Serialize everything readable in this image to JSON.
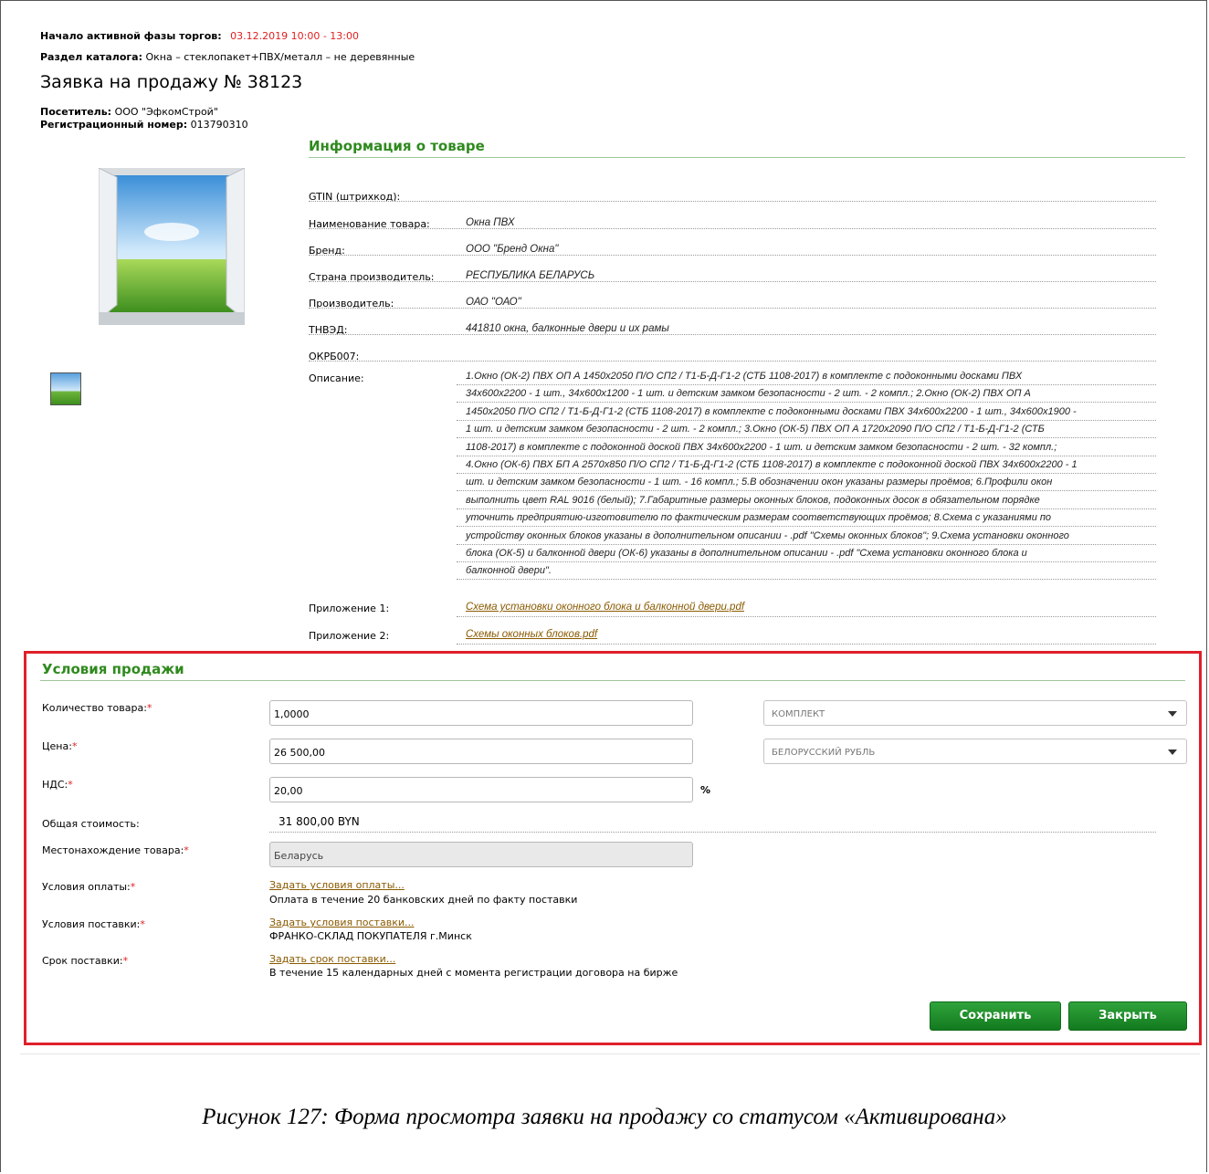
{
  "header": {
    "trade_start_label": "Начало активной фазы торгов:",
    "trade_start_value": "03.12.2019 10:00 - 13:00",
    "catalog_label": "Раздел каталога:",
    "catalog_value": "Окна – стеклопакет+ПВХ/металл – не деревянные",
    "title": "Заявка на продажу № 38123",
    "visitor_label": "Посетитель:",
    "visitor_value": "ООО \"ЭфкомСтрой\"",
    "regnum_label": "Регистрационный номер:",
    "regnum_value": "013790310"
  },
  "product": {
    "section_title": "Информация о товаре",
    "rows": [
      {
        "label": "GTIN (штрихкод):",
        "value": ""
      },
      {
        "label": "Наименование товара:",
        "value": "Окна ПВХ"
      },
      {
        "label": "Бренд:",
        "value": "ООО \"Бренд Окна\""
      },
      {
        "label": "Страна производитель:",
        "value": "РЕСПУБЛИКА БЕЛАРУСЬ"
      },
      {
        "label": "Производитель:",
        "value": "ОАО \"ОАО\""
      },
      {
        "label": "ТНВЭД:",
        "value": "441810 окна, балконные двери и их рамы"
      },
      {
        "label": "ОКРБ007:",
        "value": ""
      }
    ],
    "description_label": "Описание:",
    "description_lines": [
      "1.Окно (ОК-2) ПВХ ОП А 1450x2050 П/О СП2 / Т1-Б-Д-Г1-2 (СТБ 1108-2017) в комплекте с подоконными досками ПВХ",
      "34x600x2200 - 1 шт., 34x600x1200 - 1 шт. и детским замком безопасности - 2 шт. - 2 компл.; 2.Окно (ОК-2) ПВХ ОП А",
      "1450x2050 П/О СП2 / Т1-Б-Д-Г1-2 (СТБ 1108-2017) в комплекте с подоконными досками ПВХ 34x600x2200 - 1 шт., 34x600x1900 -",
      "1 шт. и детским замком безопасности - 2 шт. - 2 компл.; 3.Окно (ОК-5) ПВХ ОП А 1720x2090 П/О СП2 / Т1-Б-Д-Г1-2 (СТБ",
      "1108-2017) в комплекте с подоконной доской ПВХ 34x600x2200 - 1 шт. и детским замком безопасности - 2 шт. - 32 компл.;",
      "4.Окно (ОК-6) ПВХ БП А 2570x850 П/О СП2 / Т1-Б-Д-Г1-2 (СТБ 1108-2017) в комплекте с подоконной доской ПВХ 34x600x2200 - 1",
      "шт. и детским замком безопасности - 1 шт. - 16 компл.; 5.В обозначении окон указаны размеры проёмов; 6.Профили окон",
      "выполнить цвет RAL 9016 (белый); 7.Габаритные размеры оконных блоков, подоконных досок в обязательном порядке",
      "уточнить предприятию-изготовителю по фактическим размерам соответствующих проёмов; 8.Схема с указаниями по",
      "устройству оконных блоков указаны в дополнительном описании - .pdf \"Схемы оконных блоков\"; 9.Схема установки оконного",
      "блока (ОК-5) и балконной двери (ОК-6) указаны в дополнительном описании - .pdf \"Схема установки оконного блока и",
      "балконной двери\"."
    ],
    "attach1_label": "Приложение 1:",
    "attach1_link": "Схема установки оконного блока и балконной двери.pdf",
    "attach2_label": "Приложение 2:",
    "attach2_link": "Схемы оконных блоков.pdf"
  },
  "sale": {
    "section_title": "Условия продажи",
    "qty_label": "Количество товара:",
    "qty_value": "1,0000",
    "unit_select": "КОМПЛЕКТ",
    "price_label": "Цена:",
    "price_value": "26 500,00",
    "currency_select": "БЕЛОРУССКИЙ РУБЛЬ",
    "vat_label": "НДС:",
    "vat_value": "20,00",
    "vat_unit": "%",
    "total_label": "Общая стоимость:",
    "total_value": "31 800,00 BYN",
    "location_label": "Местонахождение товара:",
    "location_value": "Беларусь",
    "payment_label": "Условия оплаты:",
    "payment_link": "Задать условия оплаты...",
    "payment_text": "Оплата в течение 20 банковских дней по факту поставки",
    "delivery_label": "Условия поставки:",
    "delivery_link": "Задать условия поставки...",
    "delivery_text": "ФРАНКО-СКЛАД ПОКУПАТЕЛЯ г.Минск",
    "term_label": "Срок поставки:",
    "term_link": "Задать срок поставки...",
    "term_text": "В течение 15 календарных дней с момента регистрации договора на бирже",
    "required_mark": "*",
    "save_button": "Сохранить",
    "close_button": "Закрыть"
  },
  "caption": "Рисунок 127: Форма просмотра заявки на продажу со статусом «Активирована»",
  "colors": {
    "accent_green": "#2f8a1e",
    "highlight_red": "#e0202a",
    "link_brown": "#8a5a00"
  }
}
